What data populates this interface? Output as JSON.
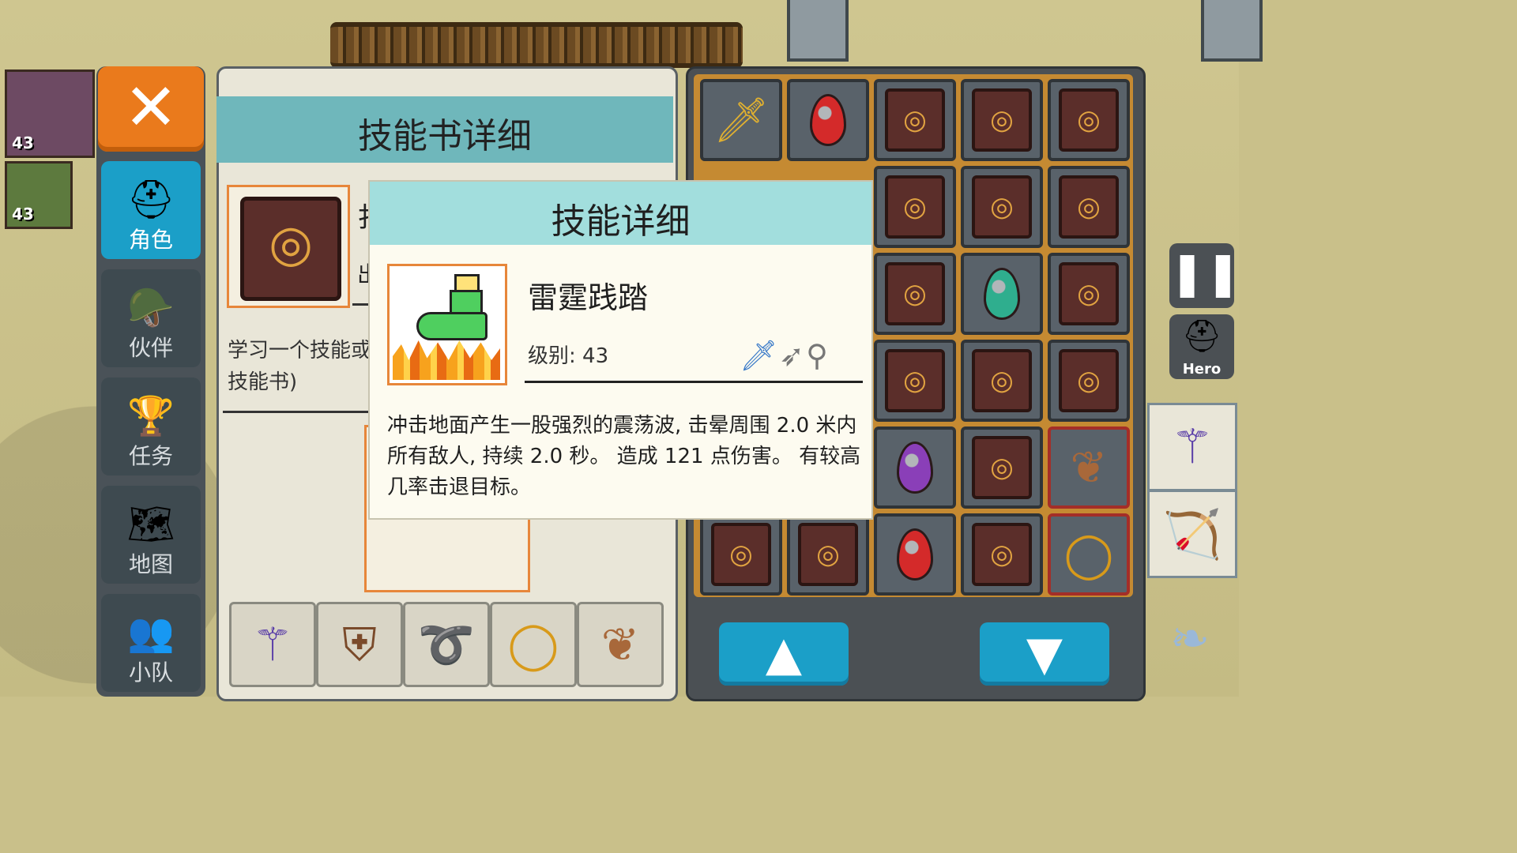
{
  "party": [
    {
      "level": "43"
    },
    {
      "level": "43"
    }
  ],
  "menu": {
    "close_icon": "✕",
    "items": [
      {
        "label": "角色",
        "icon": "knight-helmet-icon",
        "glyph": "⛑"
      },
      {
        "label": "伙伴",
        "icon": "horned-helmet-icon",
        "glyph": "🪖"
      },
      {
        "label": "任务",
        "icon": "trophy-icon",
        "glyph": "🏆"
      },
      {
        "label": "地图",
        "icon": "map-scroll-icon",
        "glyph": "🗺"
      },
      {
        "label": "小队",
        "icon": "team-portraits-icon",
        "glyph": "👥"
      }
    ]
  },
  "skillbook": {
    "title": "技能书详细",
    "name_partial": "扌",
    "sub_partial": "出",
    "description": "学习一个技能或\n技能书)"
  },
  "dialog": {
    "title": "技能详细",
    "skill_name": "雷霆践踏",
    "level_text": "级别: 43",
    "weapon_icons": [
      "sword-icon",
      "bow-icon",
      "staff-icon"
    ],
    "description": "冲击地面产生一股强烈的震荡波, 击晕周围 2.0 米内所有敌人, 持续 2.0 秒。 造成 121 点伤害。 有较高几率击退目标。"
  },
  "inventory": {
    "rows": [
      [
        "sword",
        "red-gem",
        "book",
        "book",
        "book"
      ],
      [
        "hidden",
        "hidden",
        "book",
        "book",
        "book"
      ],
      [
        "hidden",
        "hidden",
        "book",
        "teal-gem",
        "book"
      ],
      [
        "hidden",
        "hidden",
        "book",
        "book",
        "book"
      ],
      [
        "hidden",
        "hidden",
        "purple-gem",
        "book",
        "tail"
      ],
      [
        "book",
        "book",
        "red-gem",
        "book",
        "ring"
      ]
    ],
    "up_glyph": "▲",
    "down_glyph": "▼"
  },
  "equipment": [
    "staff",
    "armor",
    "bracelet",
    "ring",
    "tail"
  ],
  "hud": {
    "pause_glyph": "❚❚",
    "hero_label": "Hero"
  },
  "colors": {
    "accent_blue": "#1b9fc8",
    "accent_orange": "#ea7a1c",
    "dialog_header": "#a2dedd",
    "panel_header": "#6fb7bb"
  }
}
